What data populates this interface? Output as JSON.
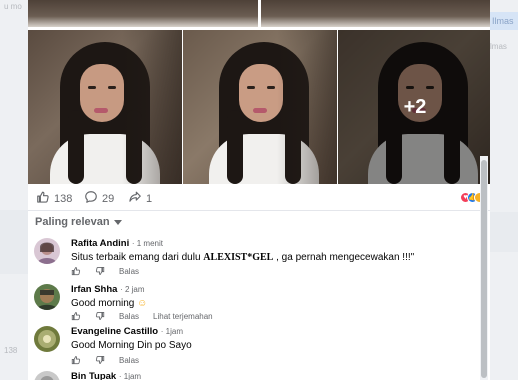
{
  "background": {
    "left_ghost_1": "u mo",
    "left_ghost_2": "138",
    "right_tag": "Ilmas",
    "right_tag_2": "lmas"
  },
  "post": {
    "more_photos": "+2"
  },
  "reactions_bar": {
    "likes": "138",
    "comments": "29",
    "shares": "1"
  },
  "sort": {
    "label": "Paling relevan"
  },
  "comments": [
    {
      "name": "Rafita Andini",
      "time": "· 1 menit",
      "text_before": "Situs terbaik emang dari dulu ",
      "text_brand": "ALEXIST*GEL",
      "text_after": " , ga pernah mengecewakan !!!\"",
      "reply_label": "Balas"
    },
    {
      "name": "Irfan Shha",
      "time": "· 2 jam",
      "text": "Good morning",
      "text_emoji": "☺",
      "reply_label": "Balas",
      "translate_label": "Lihat terjemahan"
    },
    {
      "name": "Evangeline Castillo",
      "time": "· 1jam",
      "text": "Good Morning Din po Sayo",
      "reply_label": "Balas"
    },
    {
      "name": "Bin Tupak",
      "time": "· 1jam"
    }
  ],
  "colors": {
    "like_blue": "#1877f2",
    "love_red": "#f33e58",
    "haha_yellow": "#f7b125",
    "muted_text": "#65676b"
  },
  "icons": [
    "like-icon",
    "comment-icon",
    "share-icon",
    "dislike-icon",
    "caret-down-icon"
  ]
}
